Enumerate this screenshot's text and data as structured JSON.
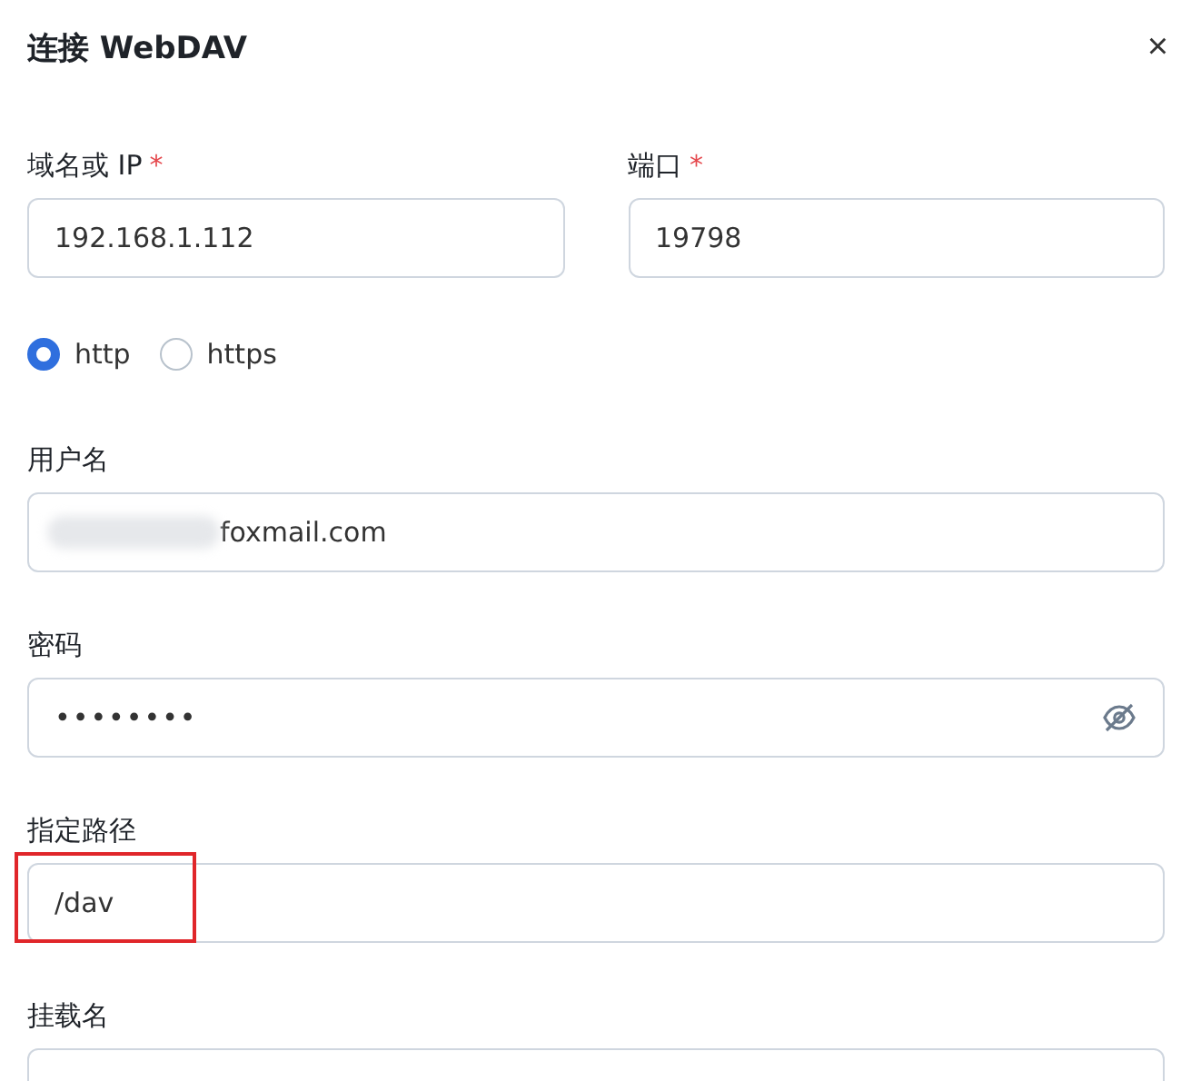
{
  "title": "连接 WebDAV",
  "close": "×",
  "row_fields": [
    {
      "label": "域名或 IP",
      "mark": "*",
      "value": "192.168.1.112"
    },
    {
      "label": "端口",
      "mark": "*",
      "value": "19798"
    }
  ],
  "protocols": [
    {
      "label": "http",
      "selected": true
    },
    {
      "label": "https",
      "selected": false
    }
  ],
  "fields": [
    {
      "kind": "blurred",
      "label": "用户名",
      "value": "foxmail.com"
    },
    {
      "kind": "password",
      "label": "密码",
      "value": "••••••••",
      "revealed": false
    },
    {
      "kind": "highlighted",
      "label": "指定路径",
      "value": "/dav"
    },
    {
      "kind": "plain",
      "label": "挂载名"
    }
  ]
}
